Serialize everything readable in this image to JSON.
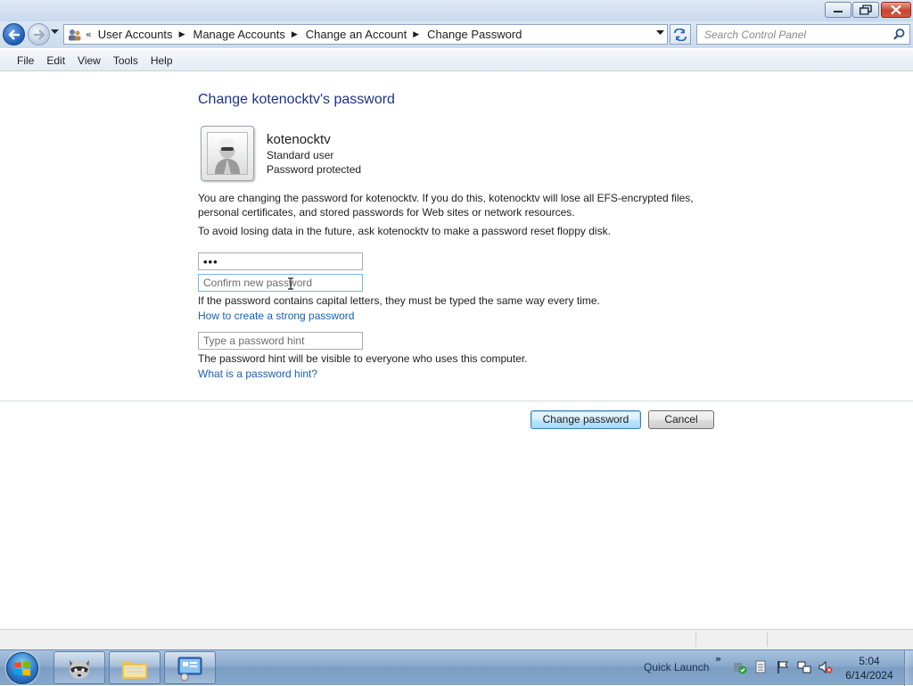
{
  "window": {
    "minimize_icon": "minimize-icon",
    "maximize_icon": "restore-icon",
    "close_icon": "close-icon"
  },
  "navigation": {
    "back_icon": "back-arrow-icon",
    "forward_icon": "forward-arrow-icon",
    "breadcrumb_prefix": "«",
    "breadcrumbs": [
      "User Accounts",
      "Manage Accounts",
      "Change an Account",
      "Change Password"
    ],
    "refresh_icon": "refresh-icon"
  },
  "search": {
    "placeholder": "Search Control Panel"
  },
  "menu": {
    "items": [
      "File",
      "Edit",
      "View",
      "Tools",
      "Help"
    ]
  },
  "page": {
    "title": "Change kotenocktv's password",
    "user": {
      "name": "kotenocktv",
      "type": "Standard user",
      "status": "Password protected"
    },
    "warning_text": "You are changing the password for kotenocktv.  If you do this, kotenocktv will lose all EFS-encrypted files, personal certificates, and stored passwords for Web sites or network resources.",
    "advice_text": "To avoid losing data in the future, ask kotenocktv to make a password reset floppy disk.",
    "new_password_value": "•••",
    "confirm_placeholder": "Confirm new password",
    "capital_note": "If the password contains capital letters, they must be typed the same way every time.",
    "strong_password_link": "How to create a strong password",
    "hint_placeholder": "Type a password hint",
    "hint_note": "The password hint will be visible to everyone who uses this computer.",
    "hint_link": "What is a password hint?",
    "change_button": "Change password",
    "cancel_button": "Cancel"
  },
  "taskbar": {
    "quick_launch": "Quick Launch",
    "chevron": "»",
    "time": "5:04",
    "date": "6/14/2024"
  },
  "colors": {
    "title_blue": "#1e3287",
    "link_blue": "#1a5fb4",
    "taskbar": "#86a7cb"
  }
}
